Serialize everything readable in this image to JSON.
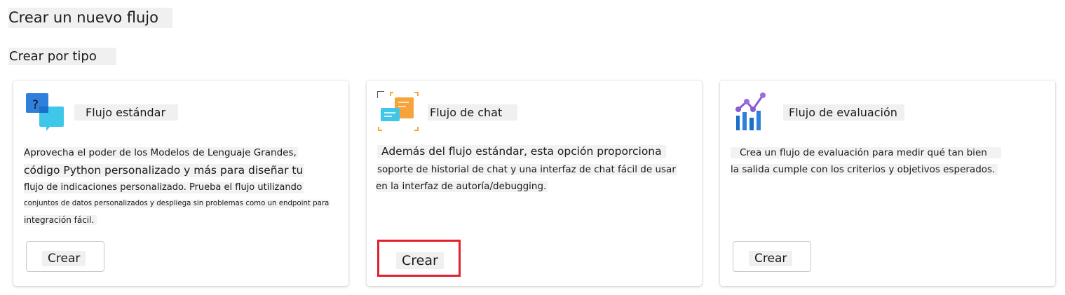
{
  "page": {
    "title": "Crear un nuevo flujo",
    "section_title": "Crear por tipo"
  },
  "cards": [
    {
      "title": "Flujo estándar",
      "icon": "question-chat-bubbles-icon",
      "description_lines": [
        "Aprovecha el poder de los Modelos de Lenguaje Grandes,",
        "código Python personalizado y más para diseñar tu",
        "flujo de indicaciones personalizado. Prueba el flujo utilizando",
        "conjuntos de datos personalizados y despliega sin problemas como un endpoint para",
        "integración fácil."
      ],
      "button_label": "Crear"
    },
    {
      "title": "Flujo de chat",
      "icon": "chat-conversation-icon",
      "description_lines": [
        "Además del flujo estándar, esta opción proporciona",
        "soporte de historial de chat y una interfaz de chat fácil de usar",
        "en la interfaz de autoría/debugging."
      ],
      "button_label": "Crear"
    },
    {
      "title": "Flujo de evaluación",
      "icon": "evaluation-chart-icon",
      "description_lines": [
        "Crea un flujo de evaluación para medir qué tan bien",
        "la salida cumple con los criterios y objetivos esperados."
      ],
      "button_label": "Crear"
    }
  ],
  "colors": {
    "highlight": "#e3212a",
    "chip_background": "#f0f0f0"
  }
}
